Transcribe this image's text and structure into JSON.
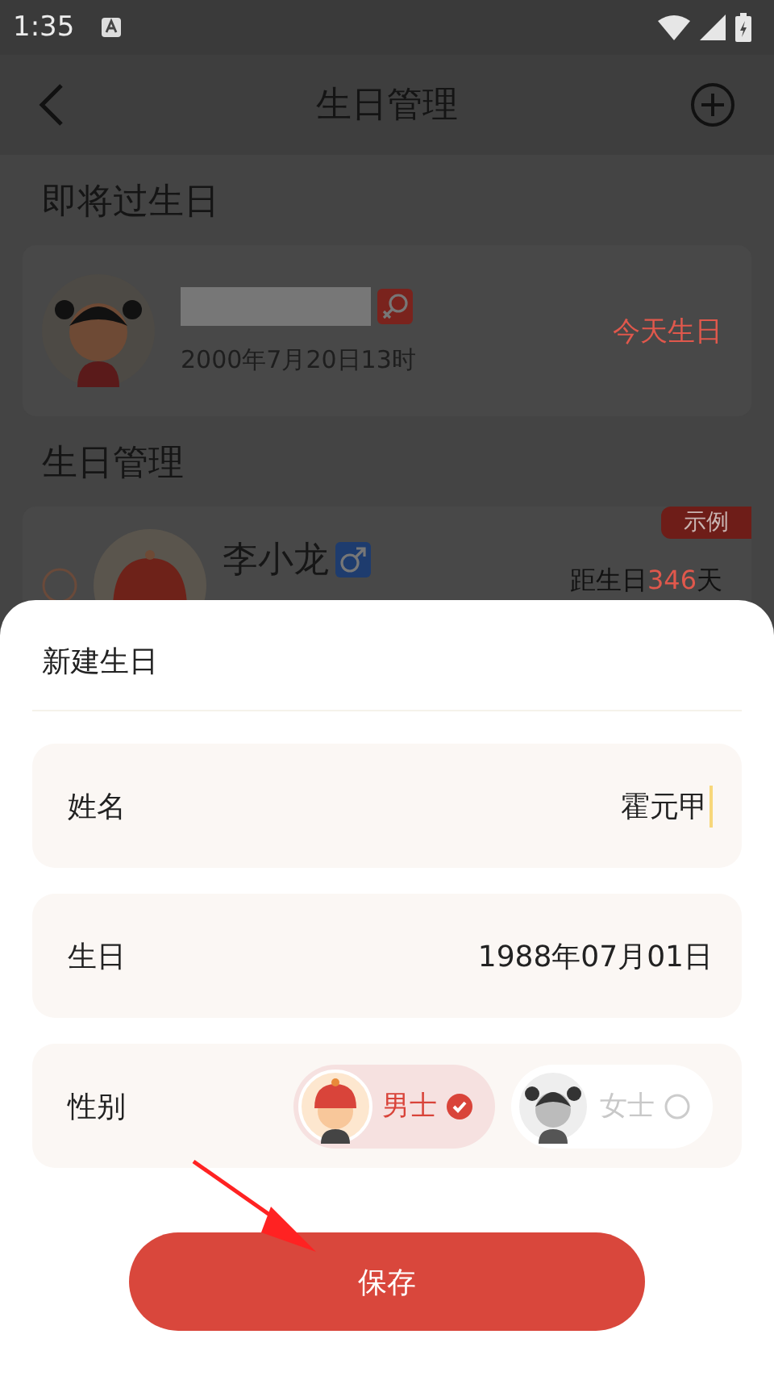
{
  "status_bar": {
    "time": "1:35"
  },
  "header": {
    "title": "生日管理"
  },
  "upcoming": {
    "heading": "即将过生日",
    "person": {
      "kind": "female",
      "date": "2000年7月20日13时",
      "status": "今天生日"
    }
  },
  "manage": {
    "heading": "生日管理",
    "items": [
      {
        "name": "李小龙",
        "kind": "male",
        "badge": "示例",
        "countdown_prefix": "距生日",
        "countdown_days": "346",
        "countdown_unit": "天"
      }
    ]
  },
  "sheet": {
    "title": "新建生日",
    "fields": [
      {
        "kind": "input",
        "label": "姓名",
        "value": "霍元甲"
      },
      {
        "kind": "picker",
        "label": "生日",
        "value": "1988年07月01日"
      }
    ],
    "gender": {
      "label": "性别",
      "options": [
        {
          "kind": "male",
          "label": "男士",
          "selected": true
        },
        {
          "kind": "female",
          "label": "女士",
          "selected": false
        }
      ]
    },
    "save": "保存"
  }
}
